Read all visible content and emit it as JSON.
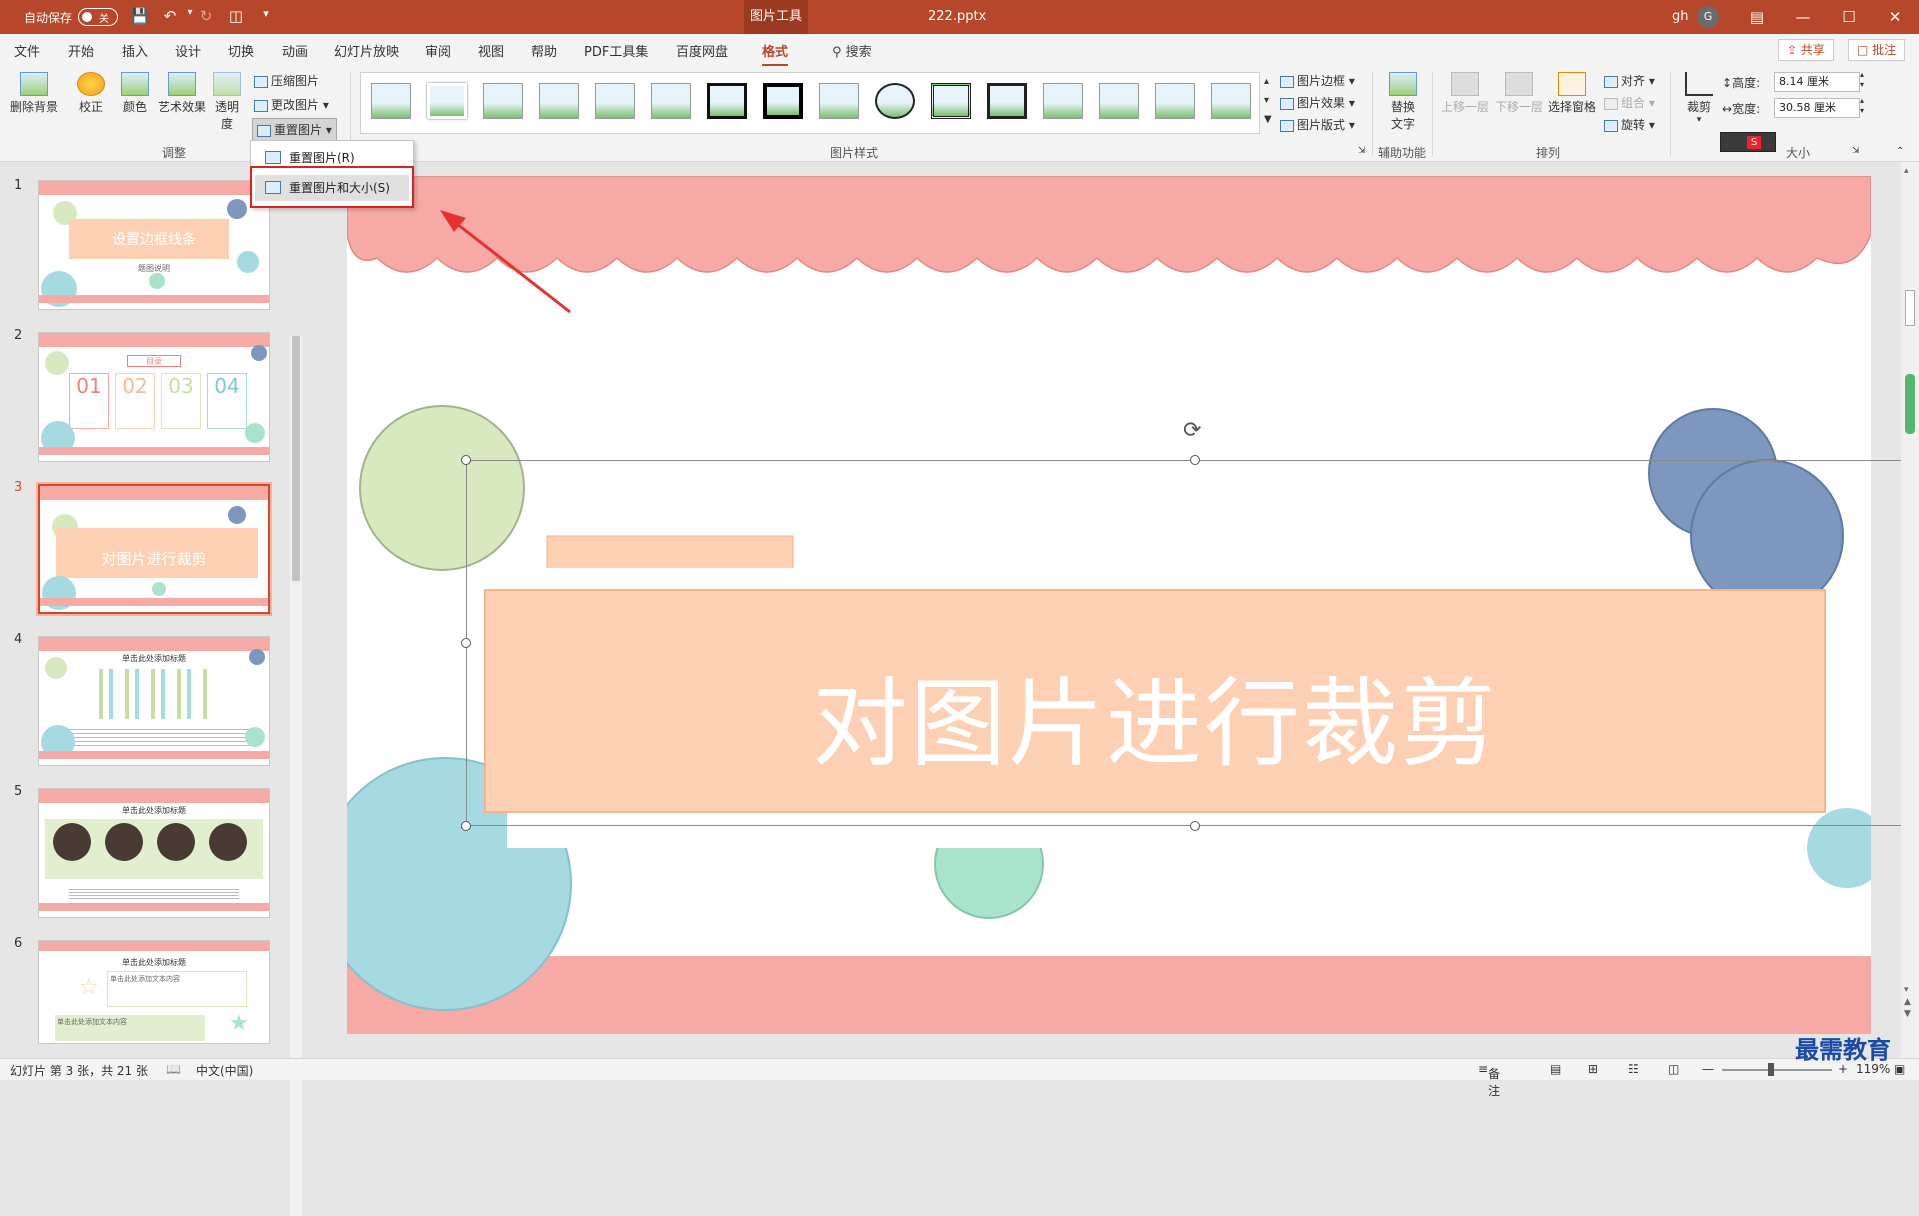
{
  "titlebar": {
    "autosave_label": "自动保存",
    "autosave_state": "关",
    "tool_tab": "图片工具",
    "filename": "222.pptx",
    "user": "gh",
    "avatar_initial": "G"
  },
  "tabs": [
    "文件",
    "开始",
    "插入",
    "设计",
    "切换",
    "动画",
    "幻灯片放映",
    "审阅",
    "视图",
    "帮助",
    "PDF工具集",
    "百度网盘",
    "格式"
  ],
  "active_tab": "格式",
  "search_label": "搜索",
  "share_label": "共享",
  "comment_label": "批注",
  "ribbon": {
    "remove_bg": "删除背景",
    "correct": "校正",
    "color": "颜色",
    "art_effects": "艺术效果",
    "transparency": "透明度",
    "compress": "压缩图片",
    "change_pic": "更改图片",
    "reset_pic": "重置图片",
    "adjust_group": "调整",
    "picture_styles_group": "图片样式",
    "pic_border": "图片边框",
    "pic_effects": "图片效果",
    "pic_layout": "图片版式",
    "alt_text_1": "替换",
    "alt_text_2": "文字",
    "accessibility_group": "辅助功能",
    "bring_forward": "上移一层",
    "send_backward": "下移一层",
    "selection_pane": "选择窗格",
    "align": "对齐",
    "group": "组合",
    "rotate": "旋转",
    "arrange_group": "排列",
    "crop": "裁剪",
    "height_label": "高度:",
    "height_value": "8.14 厘米",
    "width_label": "宽度:",
    "width_value": "30.58 厘米",
    "size_group": "大小"
  },
  "dropdown_menu": {
    "item1": "重置图片(R)",
    "item2": "重置图片和大小(S)"
  },
  "slides": [
    {
      "num": "1",
      "title": "设置边框线条",
      "subtitle": "题图说明"
    },
    {
      "num": "2",
      "title": "目录",
      "items": [
        "01",
        "02",
        "03",
        "04"
      ]
    },
    {
      "num": "3",
      "title": "对图片进行裁剪"
    },
    {
      "num": "4",
      "title": "单击此处添加标题"
    },
    {
      "num": "5",
      "title": "单击此处添加标题"
    },
    {
      "num": "6",
      "title": "单击此处添加标题",
      "sub1": "单击此处添加文本内容",
      "sub2": "单击此处添加文本内容"
    }
  ],
  "main_slide": {
    "title": "对图片进行裁剪"
  },
  "statusbar": {
    "slide_info": "幻灯片 第 3 张，共 21 张",
    "language": "中文(中国)",
    "notes": "备注",
    "zoom": "119%"
  },
  "watermark": "最需教育",
  "colors": {
    "accent": "#b7472a",
    "salmon": "#f7a9a6",
    "peach": "#fdd0b4",
    "blue_circle": "#7d97be",
    "green_circle": "#d8e9c0",
    "cyan_circle": "#a5dae2",
    "mint_circle": "#a8e3cc"
  }
}
